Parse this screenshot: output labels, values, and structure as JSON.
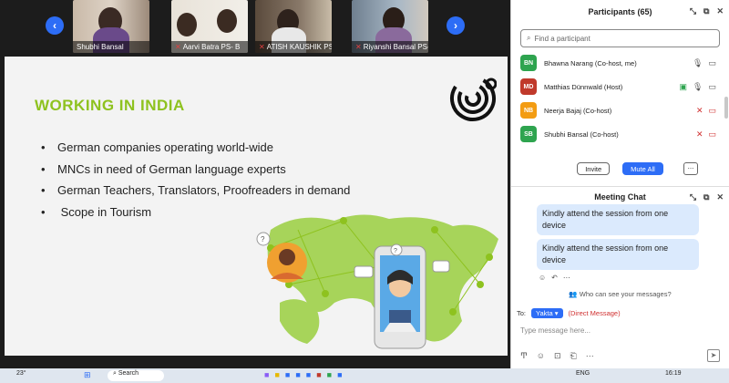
{
  "video_tiles": [
    {
      "name": "Shubhi Bansal",
      "mic_muted": false
    },
    {
      "name": "Aarvi Batra PS- B",
      "mic_muted": true
    },
    {
      "name": "ATISH KAUSHIK PS-C",
      "mic_muted": true
    },
    {
      "name": "Riyanshi Bansal PS-C",
      "mic_muted": true
    }
  ],
  "nav": {
    "prev": "‹",
    "next": "›"
  },
  "slide": {
    "title": "WORKING IN INDIA",
    "bullets": [
      "German companies operating world-wide",
      "MNCs in need of German language experts",
      "German Teachers, Translators, Proofreaders in demand",
      " Scope in Tourism"
    ]
  },
  "participants_panel": {
    "title": "Participants (65)",
    "search_placeholder": "Find a participant",
    "participants": [
      {
        "initials": "BN",
        "name": "Bhawna Narang (Co-host, me)",
        "color": "#2ea44f"
      },
      {
        "initials": "MD",
        "name": "Matthias Dünnwald (Host)",
        "color": "#c0392b"
      },
      {
        "initials": "NB",
        "name": "Neerja Bajaj (Co-host)",
        "color": "#f39c12"
      },
      {
        "initials": "SB",
        "name": "Shubhi Bansal (Co-host)",
        "color": "#2ea44f"
      }
    ],
    "invite_label": "Invite",
    "mute_all_label": "Mute All",
    "more_label": "..."
  },
  "chat": {
    "title": "Meeting Chat",
    "messages": [
      "Kindly attend the session from one device",
      "Kindly attend the session from one device"
    ],
    "who_can_see": "Who can see your messages?",
    "to_label": "To:",
    "recipient": "Yakta",
    "direct_label": "(Direct Message)",
    "input_placeholder": "Type message here..."
  },
  "taskbar": {
    "weather": "23°",
    "search": "Search",
    "language": "ENG",
    "time": "16:19"
  },
  "colors": {
    "accent": "#2d6df6",
    "slide_title": "#8ec21f"
  }
}
